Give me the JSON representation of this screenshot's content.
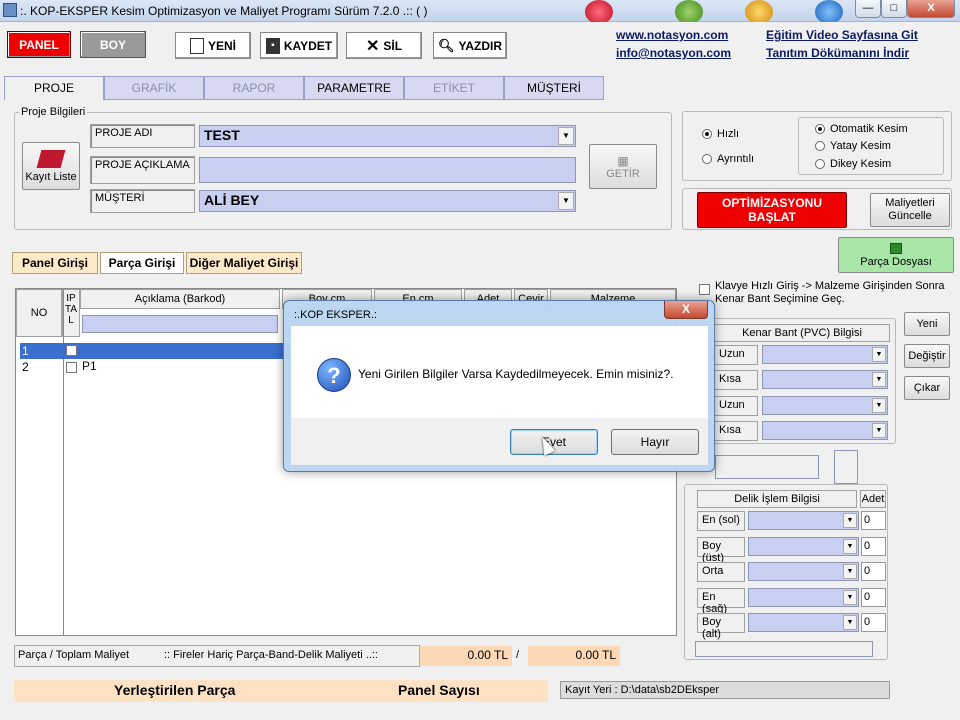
{
  "window": {
    "title": ":. KOP-EKSPER Kesim Optimizasyon ve Maliyet Programı Sürüm 7.2.0 .:: ( )",
    "minimize": "—",
    "maximize": "□",
    "close": "X"
  },
  "toolbar": {
    "panel": "PANEL",
    "boy": "BOY",
    "yeni": "YENİ",
    "kaydet": "KAYDET",
    "sil": "SİL",
    "yazdir": "YAZDIR"
  },
  "links": {
    "website": "www.notasyon.com",
    "email": "info@notasyon.com",
    "video": "Eğitim Video Sayfasına Git",
    "doc": "Tanıtım Dökümanını İndir"
  },
  "tabs": [
    "PROJE",
    "GRAFİK",
    "RAPOR",
    "PARAMETRE",
    "ETİKET",
    "MÜŞTERİ"
  ],
  "project": {
    "group_label": "Proje Bilgileri",
    "kayit_liste": "Kayıt Liste",
    "name_label": "PROJE ADI",
    "name_value": "TEST",
    "desc_label": "PROJE AÇIKLAMA",
    "desc_value": "",
    "customer_label": "MÜŞTERİ",
    "customer_value": "ALİ BEY",
    "getir": "GETİR"
  },
  "options": {
    "hizli": "Hızlı",
    "ayrintili": "Ayrıntılı",
    "otomatik": "Otomatik Kesim",
    "yatay": "Yatay Kesim",
    "dikey": "Dikey Kesim"
  },
  "actions": {
    "optimize": "OPTİMİZASYONU BAŞLAT",
    "maliyet": "Maliyetleri Güncelle",
    "parca_dosyasi": "Parça Dosyası"
  },
  "subtabs": [
    "Panel Girişi",
    "Parça Girişi",
    "Diğer Maliyet Girişi"
  ],
  "grid": {
    "headers": {
      "no": "NO",
      "iptal": "IP TA L",
      "aciklama": "Açıklama (Barkod)",
      "boy": "Boy cm",
      "en": "En cm",
      "adet": "Adet",
      "cevir": "Çevir",
      "malzeme": "Malzeme"
    },
    "rows": [
      {
        "no": "1",
        "desc": ""
      },
      {
        "no": "2",
        "desc": "P1"
      }
    ]
  },
  "side": {
    "klavye": "Klavye Hızlı Giriş -> Malzeme Girişinden Sonra Kenar Bant Seçimine Geç.",
    "kenar_title": "Kenar Bant (PVC) Bilgisi",
    "kenar_rows": [
      "Uzun",
      "Kısa",
      "Uzun",
      "Kısa"
    ],
    "yeni": "Yeni",
    "degistir": "Değiştir",
    "cikar": "Çıkar",
    "delik_title": "Delik İşlem Bilgisi",
    "adet_title": "Adet",
    "delik_rows": [
      {
        "label": "En (sol)",
        "adet": "0"
      },
      {
        "label": "Boy (üst)",
        "adet": "0"
      },
      {
        "label": "Orta",
        "adet": "0"
      },
      {
        "label": "En (sağ)",
        "adet": "0"
      },
      {
        "label": "Boy (alt)",
        "adet": "0"
      }
    ]
  },
  "status": {
    "parca_toplam": "Parça / Toplam Maliyet",
    "fireler": ":: Fireler Hariç Parça-Band-Delik Maliyeti ..::",
    "cost1": "0.00 TL",
    "sep": "/",
    "cost2": "0.00 TL",
    "yerlestirilen": "Yerleştirilen Parça",
    "panel_sayisi": "Panel Sayısı",
    "kayit_yeri": "Kayıt Yeri : D:\\data\\sb2DEksper"
  },
  "dialog": {
    "title": ":.KOP EKSPER.:",
    "close": "X",
    "message": "Yeni Girilen Bilgiler Varsa Kaydedilmeyecek. Emin misiniz?.",
    "yes": "Evet",
    "no": "Hayır",
    "icon": "question-icon"
  }
}
